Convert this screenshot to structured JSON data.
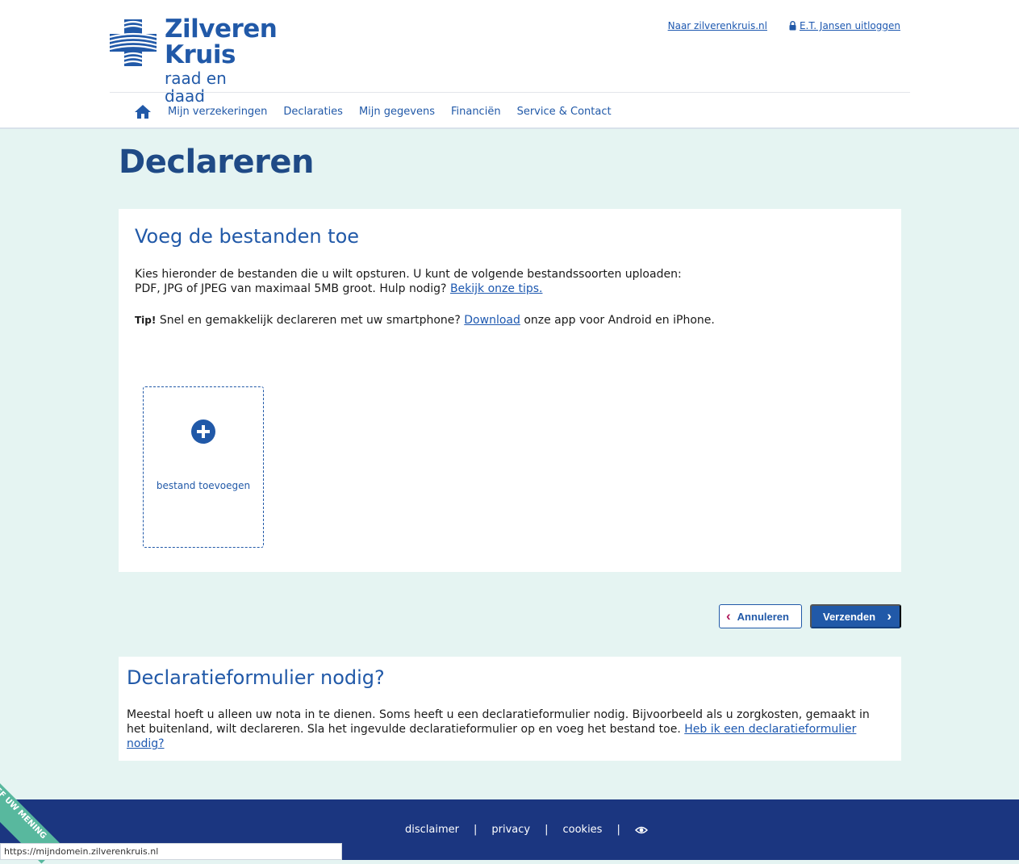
{
  "header": {
    "logo": {
      "line1": "Zilveren",
      "line2": "Kruis",
      "tagline": "raad en daad"
    },
    "links": {
      "site": "Naar zilverenkruis.nl",
      "logout": "E.T. Jansen uitloggen"
    },
    "nav": [
      "Mijn verzekeringen",
      "Declaraties",
      "Mijn gegevens",
      "Financiën",
      "Service & Contact"
    ]
  },
  "main": {
    "title": "Declareren",
    "upload_card": {
      "heading": "Voeg de bestanden toe",
      "intro_line1": "Kies hieronder de bestanden die u wilt opsturen. U kunt de volgende bestandssoorten uploaden:",
      "intro_line2": "PDF, JPG of JPEG van maximaal 5MB groot. Hulp nodig?",
      "intro_link": "Bekijk onze tips.",
      "tip_label": "Tip!",
      "tip_text": "Snel en gemakkelijk declareren met uw smartphone?",
      "tip_link": "Download",
      "tip_suffix": "onze app voor Android en iPhone.",
      "add_file_label": "bestand toevoegen"
    },
    "buttons": {
      "cancel": "Annuleren",
      "send": "Verzenden"
    },
    "form_card": {
      "heading": "Declaratieformulier nodig?",
      "text": "Meestal hoeft u alleen uw nota in te dienen. Soms heeft u een declaratieformulier nodig. Bijvoorbeeld als u zorgkosten, gemaakt in het buitenland, wilt declareren. Sla het ingevulde declaratieformulier op en voeg het bestand toe.",
      "link": "Heb ik een declaratieformulier nodig?"
    }
  },
  "footer": {
    "links": [
      "disclaimer",
      "privacy",
      "cookies"
    ],
    "separator": "|"
  },
  "feedback_tab": "GEEF UW MENING",
  "status_url": "https://mijndomein.zilverenkruis.nl",
  "colors": {
    "brand": "#2159a8",
    "footer": "#1b3680",
    "background": "#e5f4f2",
    "accent": "#b0185a"
  }
}
